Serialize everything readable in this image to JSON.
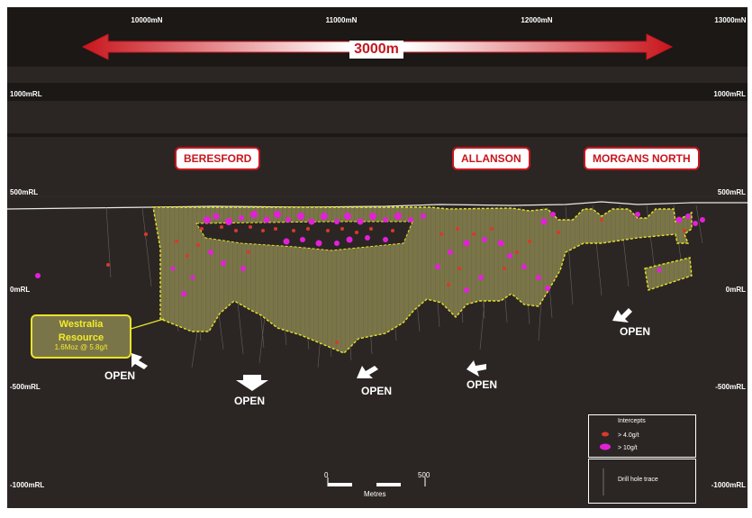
{
  "northings": [
    "10000mN",
    "11000mN",
    "12000mN",
    "13000mN"
  ],
  "rl_labels": [
    "1000mRL",
    "500mRL",
    "0mRL",
    "-500mRL",
    "-1000mRL"
  ],
  "scale_banner": "3000m",
  "deposits": [
    "BERESFORD",
    "ALLANSON",
    "MORGANS NORTH"
  ],
  "resource": {
    "name_line1": "Westralia",
    "name_line2": "Resource",
    "grade": "1.6Moz @ 5.8g/t"
  },
  "open_label": "OPEN",
  "legend": {
    "title": "Intercepts",
    "items": [
      {
        "label": "> 4.0g/t",
        "color": "#d8392b"
      },
      {
        "label": "> 10g/t",
        "color": "#e320d8"
      }
    ],
    "trace_label": "Drill hole trace"
  },
  "scale_bar": {
    "start": "0",
    "end": "500",
    "unit": "Metres"
  },
  "colors": {
    "background": "#2b2624",
    "resource_fill": "#7a7548",
    "resource_outline": "#e8e32a",
    "accent_red": "#c8161d",
    "intercept_low": "#d8392b",
    "intercept_high": "#e320d8"
  }
}
